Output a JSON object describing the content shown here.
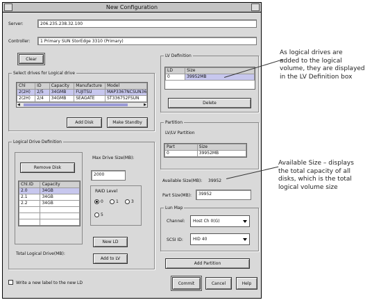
{
  "window": {
    "title": "New Configuration"
  },
  "server": {
    "label": "Server:",
    "value": "206.235.238.32.100"
  },
  "controller": {
    "label": "Controller:",
    "value": "1 Primary SUN StorEdge 3310 (Primary)"
  },
  "clear_label": "Clear",
  "select_drives": {
    "title": "Select drives for Logical drive",
    "columns": [
      "Chl",
      "ID",
      "Capacity",
      "Manufacture",
      "Model"
    ],
    "rows": [
      [
        "2(2H)",
        "2/5",
        "34GMB",
        "FUJITSU",
        "MAP3367NCSUN36"
      ],
      [
        "2(2H)",
        "2/4",
        "34GMB",
        "SEAGATE",
        "ST336752FSUN"
      ]
    ],
    "add_disk": "Add Disk",
    "make_standby": "Make Standby"
  },
  "logical_drive_def": {
    "title": "Logical Drive Definition",
    "remove_disk": "Remove Disk",
    "columns": [
      "Chl.ID",
      "Capacity"
    ],
    "rows": [
      [
        "2.0",
        "34GB"
      ],
      [
        "2.1",
        "34GB"
      ],
      [
        "2.2",
        "34GB"
      ]
    ],
    "max_drive_size_label": "Max Drive Size(MB):",
    "max_drive_size_value": "2000",
    "raid_level_label": "RAID Level",
    "raid_options": [
      "0",
      "1",
      "3",
      "5"
    ],
    "total_label": "Total Logical Drive(MB):",
    "new_ld": "New LD",
    "add_to_lv": "Add to LV"
  },
  "lv_definition": {
    "title": "LV Definition",
    "columns": [
      "LD",
      "Size"
    ],
    "rows": [
      [
        "0",
        "39952MB"
      ]
    ],
    "delete": "Delete"
  },
  "partition": {
    "title": "Partition",
    "sub_title": "LV/LV Partition",
    "columns": [
      "Part",
      "Size"
    ],
    "rows": [
      [
        "0",
        "39952MB"
      ]
    ],
    "available_label": "Available Size(MB):",
    "available_value": "39952",
    "part_size_label": "Part Size(MB):",
    "part_size_value": "39952"
  },
  "lun_map": {
    "title": "Lun Map",
    "channel_label": "Channel:",
    "channel_value": "Host Ch 0(G)",
    "scsi_label": "SCSI ID:",
    "scsi_value": "HID 40",
    "add_partition": "Add Partition"
  },
  "write_label_text": "Write a new label to the new LD",
  "buttons": {
    "commit": "Commit",
    "cancel": "Cancel",
    "help": "Help"
  },
  "annotations": {
    "lv": [
      "As logical drives are",
      "added to the logical",
      "volume, they are displayed",
      "in the LV Definition box"
    ],
    "available": [
      "Available Size – displays",
      "the total capacity of all",
      "disks, which is the total",
      "logical volume size"
    ]
  }
}
